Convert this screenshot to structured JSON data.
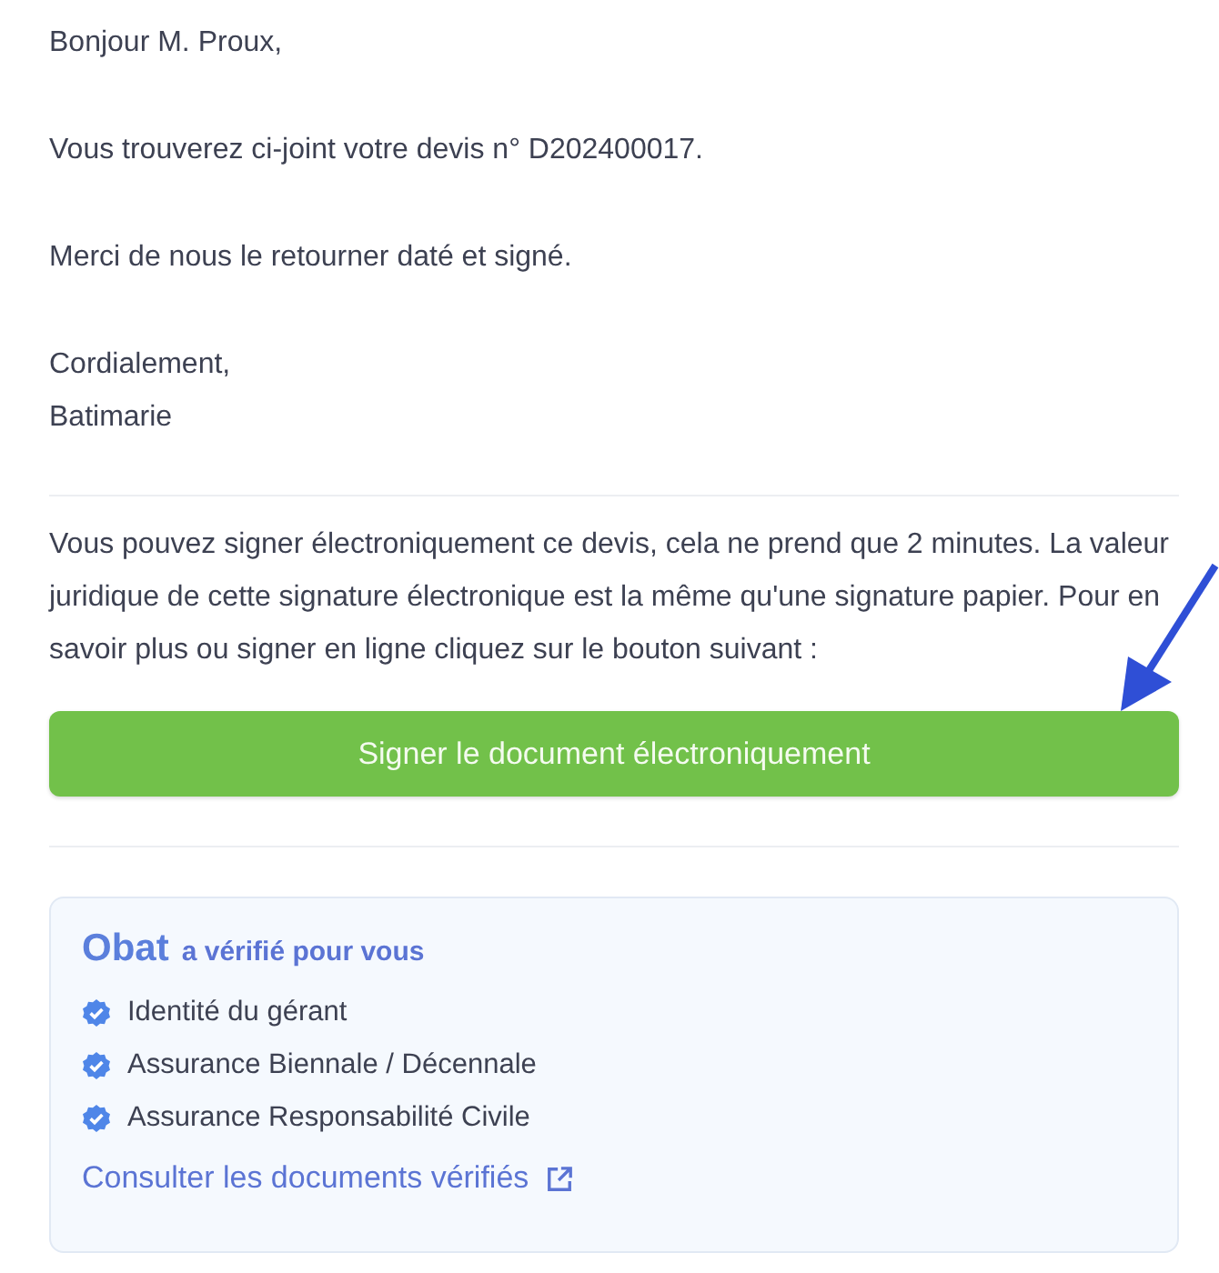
{
  "letter": {
    "greeting": "Bonjour M. Proux,",
    "body": "Vous trouverez ci-joint votre devis n° D202400017.",
    "request": "Merci de nous le retourner daté et signé.",
    "closing": "Cordialement,",
    "signature": "Batimarie"
  },
  "signing": {
    "text": "Vous pouvez signer électroniquement ce devis, cela ne prend que 2 minutes. La valeur juridique de cette signature électronique est la même qu'une signature papier. Pour en savoir plus ou signer en ligne cliquez sur le bouton suivant :",
    "button": "Signer le document électroniquement"
  },
  "verification": {
    "brand": "Obat",
    "heading": "a vérifié pour vous",
    "items": [
      {
        "label": "Identité du gérant",
        "verified": true
      },
      {
        "label": "Assurance Biennale / Décennale",
        "verified": true
      },
      {
        "label": "Assurance Responsabilité Civile",
        "verified": true
      }
    ],
    "link": "Consulter les documents vérifiés"
  }
}
